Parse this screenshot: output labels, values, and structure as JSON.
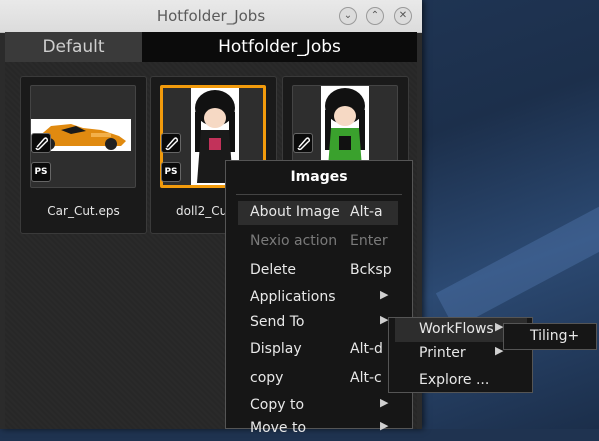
{
  "window": {
    "title": "Hotfolder_Jobs",
    "controls": {
      "minimize": "⌄",
      "maximize": "⌃",
      "close": "✕"
    }
  },
  "tabs": [
    {
      "label": "Default",
      "active": false
    },
    {
      "label": "Hotfolder_Jobs",
      "active": true
    }
  ],
  "files": [
    {
      "name": "Car_Cut.eps",
      "badge": "PS",
      "selected": false
    },
    {
      "name": "doll2_Cu",
      "badge": "PS",
      "selected": true
    },
    {
      "name": "",
      "badge": "",
      "selected": false
    }
  ],
  "context_menu": {
    "title": "Images",
    "items": [
      {
        "label": "About Image",
        "shortcut": "Alt-a"
      },
      {
        "label": "Nexio action",
        "shortcut": "Enter"
      },
      {
        "label": "Delete",
        "shortcut": "Bcksp"
      },
      {
        "label": "Applications",
        "shortcut": ""
      },
      {
        "label": "Send To",
        "shortcut": ""
      },
      {
        "label": "Display",
        "shortcut": "Alt-d"
      },
      {
        "label": "copy",
        "shortcut": "Alt-c"
      },
      {
        "label": "Copy to",
        "shortcut": ""
      },
      {
        "label": "Move to",
        "shortcut": ""
      }
    ]
  },
  "send_to_submenu": {
    "items": [
      {
        "label": "WorkFlows"
      },
      {
        "label": "Printer"
      },
      {
        "label": "Explore ..."
      }
    ]
  },
  "workflows_submenu": {
    "items": [
      {
        "label": "Tiling+"
      }
    ]
  },
  "colors": {
    "selection": "#f29b0c",
    "menu_bg": "#161616",
    "window_bg": "#2b2b2b"
  }
}
